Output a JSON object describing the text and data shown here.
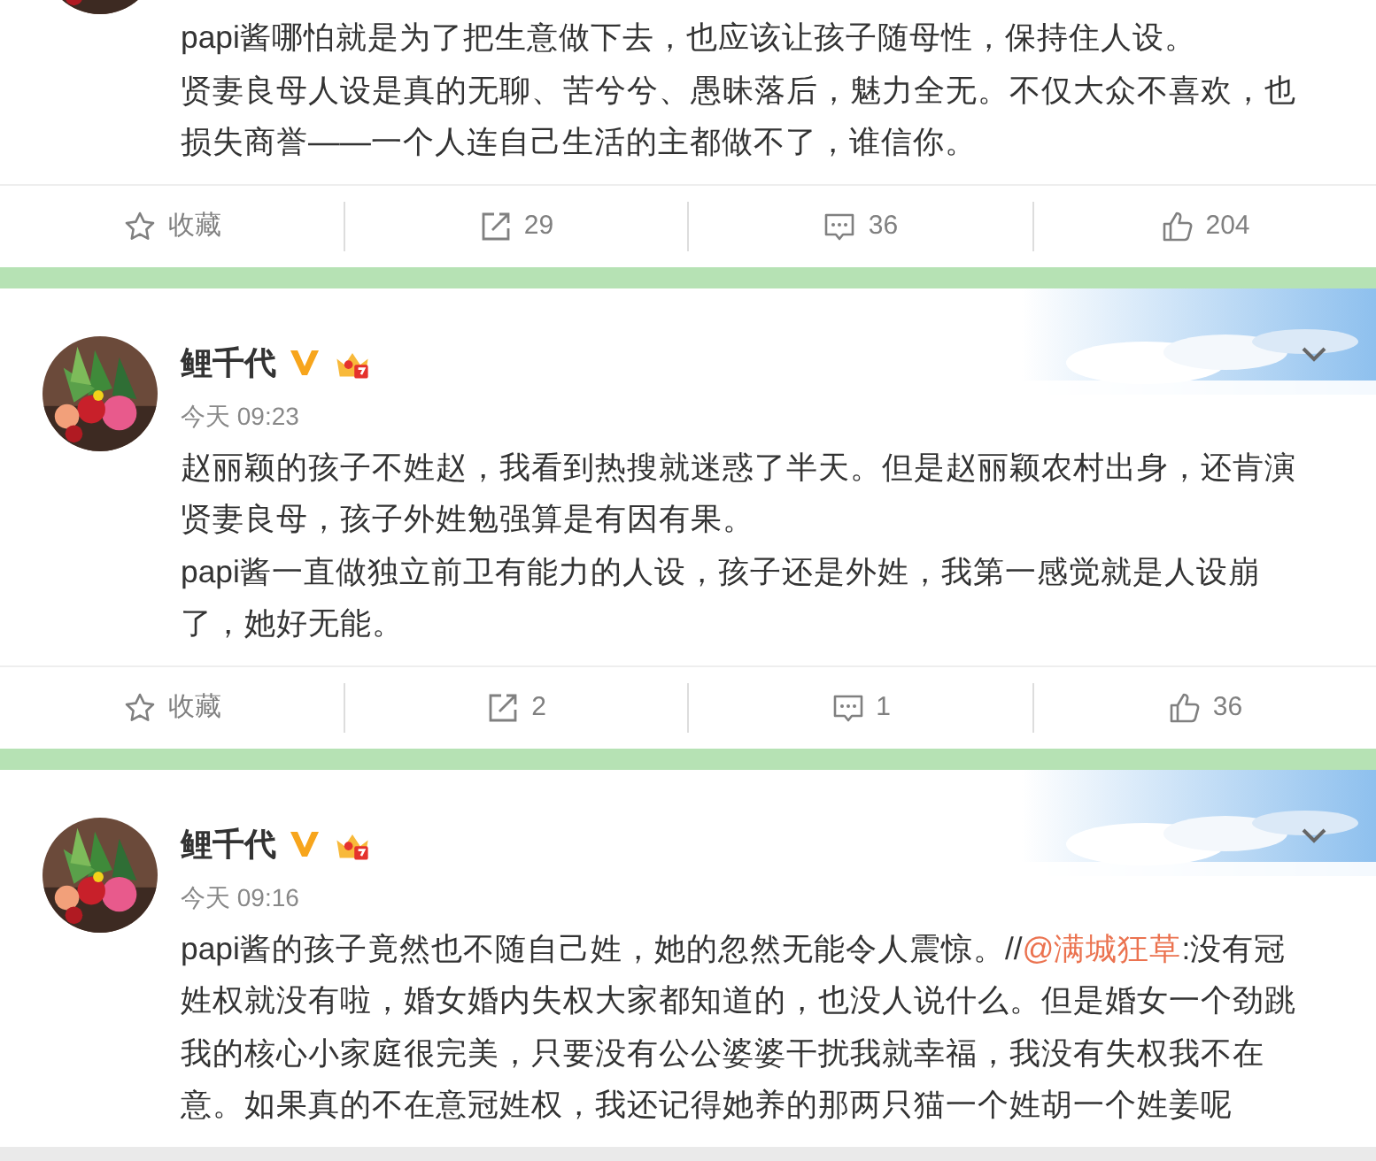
{
  "posts": [
    {
      "paragraphs": [
        [
          {
            "kind": "text",
            "text": "papi酱哪怕就是为了把生意做下去，也应该让孩子随母性，保持住人设。"
          }
        ],
        [
          {
            "kind": "text",
            "text": "贤妻良母人设是真的无聊、苦兮兮、愚昧落后，魅力全无。不仅大众不喜欢，也损失商誉——一个人连自己生活的主都做不了，谁信你。"
          }
        ]
      ],
      "actions": [
        {
          "kind": "favorite",
          "label": "收藏"
        },
        {
          "kind": "repost",
          "label": "29"
        },
        {
          "kind": "comment",
          "label": "36"
        },
        {
          "kind": "like",
          "label": "204"
        }
      ]
    },
    {
      "author": {
        "name": "鲤千代",
        "verified": true,
        "member": true
      },
      "time": "今天 09:23",
      "paragraphs": [
        [
          {
            "kind": "text",
            "text": "赵丽颖的孩子不姓赵，我看到热搜就迷惑了半天。但是赵丽颖农村出身，还肯演贤妻良母，孩子外姓勉强算是有因有果。"
          }
        ],
        [
          {
            "kind": "text",
            "text": "papi酱一直做独立前卫有能力的人设，孩子还是外姓，我第一感觉就是人设崩了，她好无能。"
          }
        ]
      ],
      "actions": [
        {
          "kind": "favorite",
          "label": "收藏"
        },
        {
          "kind": "repost",
          "label": "2"
        },
        {
          "kind": "comment",
          "label": "1"
        },
        {
          "kind": "like",
          "label": "36"
        }
      ]
    },
    {
      "author": {
        "name": "鲤千代",
        "verified": true,
        "member": true
      },
      "time": "今天 09:16",
      "paragraphs": [
        [
          {
            "kind": "text",
            "text": "papi酱的孩子竟然也不随自己姓，她的忽然无能令人震惊。//"
          },
          {
            "kind": "mention",
            "text": "@满城狂草"
          },
          {
            "kind": "text",
            "text": ":没有冠姓权就没有啦，婚女婚内失权大家都知道的，也没人说什么。但是婚女一个劲跳我的核心小家庭很完美，只要没有公公婆婆干扰我就幸福，我没有失权我不在意。如果真的不在意冠姓权，我还记得她养的那两只猫一个姓胡一个姓姜呢"
          }
        ]
      ]
    }
  ]
}
